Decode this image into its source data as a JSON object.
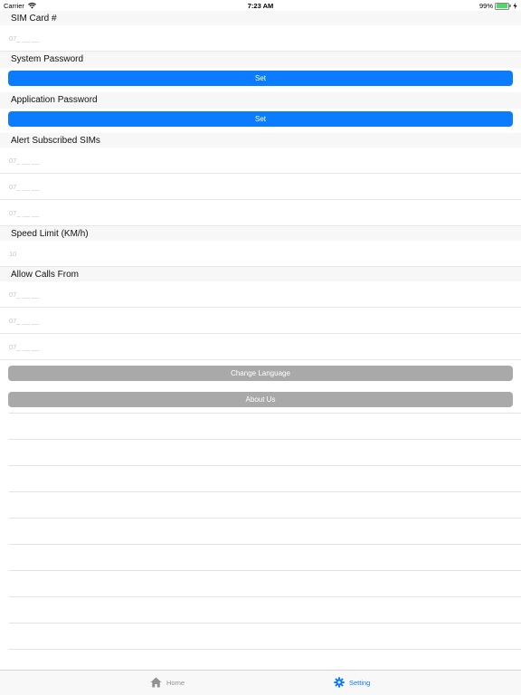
{
  "status_bar": {
    "carrier": "Carrier",
    "time": "7:23 AM",
    "battery_percent": "99%",
    "battery_level": 0.99,
    "icons": [
      "wifi-icon",
      "battery-icon",
      "charging-bolt-icon"
    ]
  },
  "sections": {
    "sim_card": {
      "header": "SIM Card #",
      "placeholder": "07_ __ __"
    },
    "system_password": {
      "header": "System Password",
      "button_label": "Set"
    },
    "application_password": {
      "header": "Application Password",
      "button_label": "Set"
    },
    "alert_subscribed_sims": {
      "header": "Alert Subscribed SIMs",
      "fields": [
        {
          "placeholder": "07_ __ __"
        },
        {
          "placeholder": "07_ __ __"
        },
        {
          "placeholder": "07_ __ __"
        }
      ]
    },
    "speed_limit": {
      "header": "Speed Limit (KM/h)",
      "placeholder": "10"
    },
    "allow_calls_from": {
      "header": "Allow Calls From",
      "fields": [
        {
          "placeholder": "07_ __ __"
        },
        {
          "placeholder": "07_ __ __"
        },
        {
          "placeholder": "07_ __ __"
        }
      ]
    }
  },
  "actions": {
    "change_language_label": "Change Language",
    "about_us_label": "About Us"
  },
  "tab_bar": {
    "tabs": [
      {
        "label": "Home",
        "icon": "home-icon",
        "selected": false
      },
      {
        "label": "Setting",
        "icon": "gear-icon",
        "selected": true
      }
    ]
  },
  "colors": {
    "accent": "#0b7cfd",
    "secondary_button": "#a9a9a9",
    "section_background": "#f7f7f7",
    "battery": "#4cd964",
    "tab_inactive": "#929292"
  }
}
